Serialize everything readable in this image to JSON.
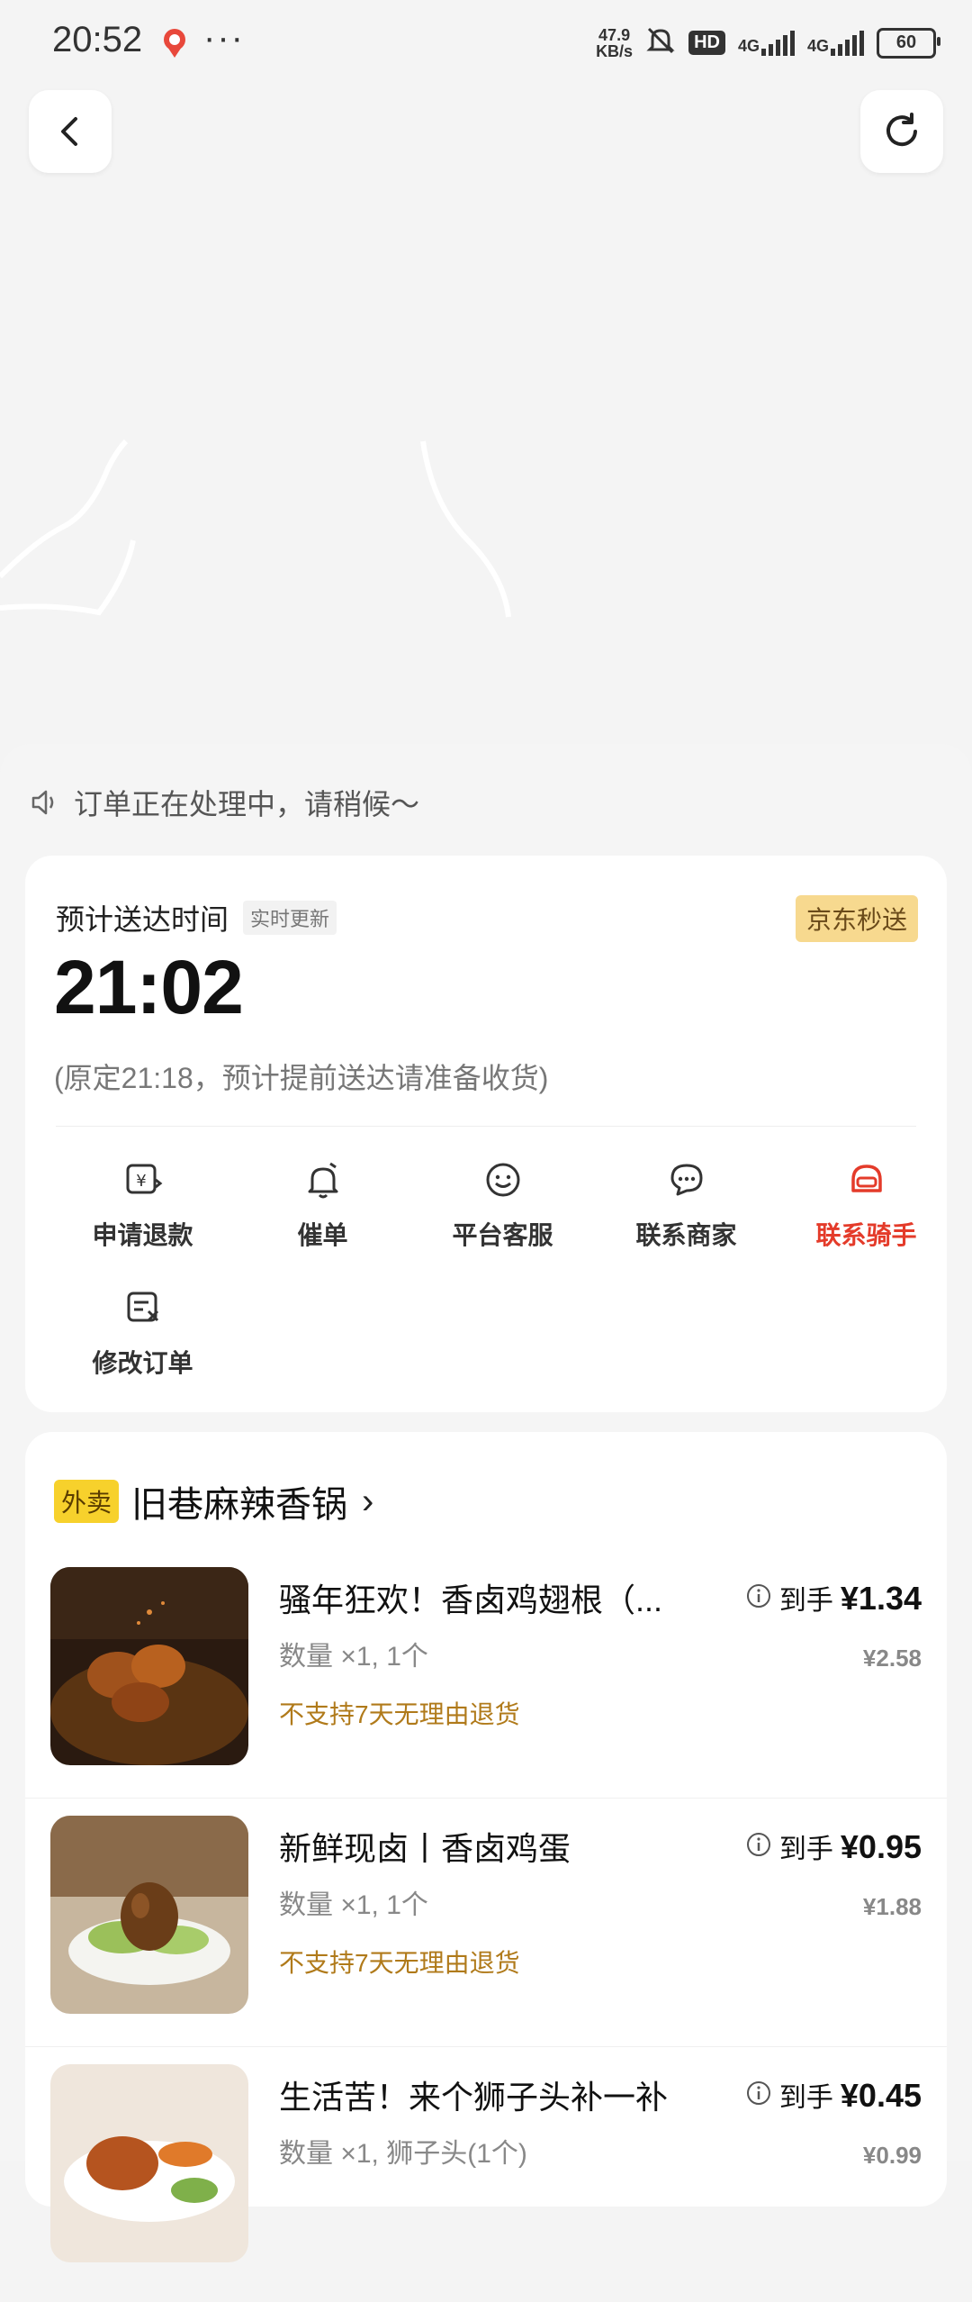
{
  "status_bar": {
    "time": "20:52",
    "dots": "···",
    "net_speed_value": "47.9",
    "net_speed_unit": "KB/s",
    "hd": "HD",
    "net1": "4G",
    "net2": "4G",
    "battery": "60"
  },
  "notice": "订单正在处理中，请稍候～",
  "delivery": {
    "eta_label": "预计送达时间",
    "eta_tag": "实时更新",
    "brand": "京东秒送",
    "eta_time": "21:02",
    "eta_note": "(原定21:18，预计提前送达请准备收货)"
  },
  "actions": [
    {
      "label": "申请退款",
      "icon": "refund-icon"
    },
    {
      "label": "催单",
      "icon": "bell-icon"
    },
    {
      "label": "平台客服",
      "icon": "smile-icon"
    },
    {
      "label": "联系商家",
      "icon": "merchant-chat-icon"
    },
    {
      "label": "联系骑手",
      "icon": "rider-helmet-icon",
      "color": "#e43b2a"
    },
    {
      "label": "修改订单",
      "icon": "edit-order-icon"
    }
  ],
  "store": {
    "tag": "外卖",
    "name": "旧巷麻辣香锅",
    "chevron": "›"
  },
  "items": [
    {
      "name": "骚年狂欢！香卤鸡翅根（...",
      "qty": "数量 ×1, 1个",
      "policy": "不支持7天无理由退货",
      "price_label": "到手",
      "price": "¥1.34",
      "orig_price": "¥2.58"
    },
    {
      "name": "新鲜现卤丨香卤鸡蛋",
      "qty": "数量 ×1, 1个",
      "policy": "不支持7天无理由退货",
      "price_label": "到手",
      "price": "¥0.95",
      "orig_price": "¥1.88"
    },
    {
      "name": "生活苦！来个狮子头补一补",
      "qty": "数量 ×1, 狮子头(1个)",
      "price_label": "到手",
      "price": "¥0.45",
      "orig_price": "¥0.99"
    }
  ],
  "colors": {
    "accent_red": "#e43b2a",
    "brand_tag_bg": "#f7d98f",
    "store_tag_bg": "#f7d12c",
    "policy_text": "#b07a1a"
  }
}
